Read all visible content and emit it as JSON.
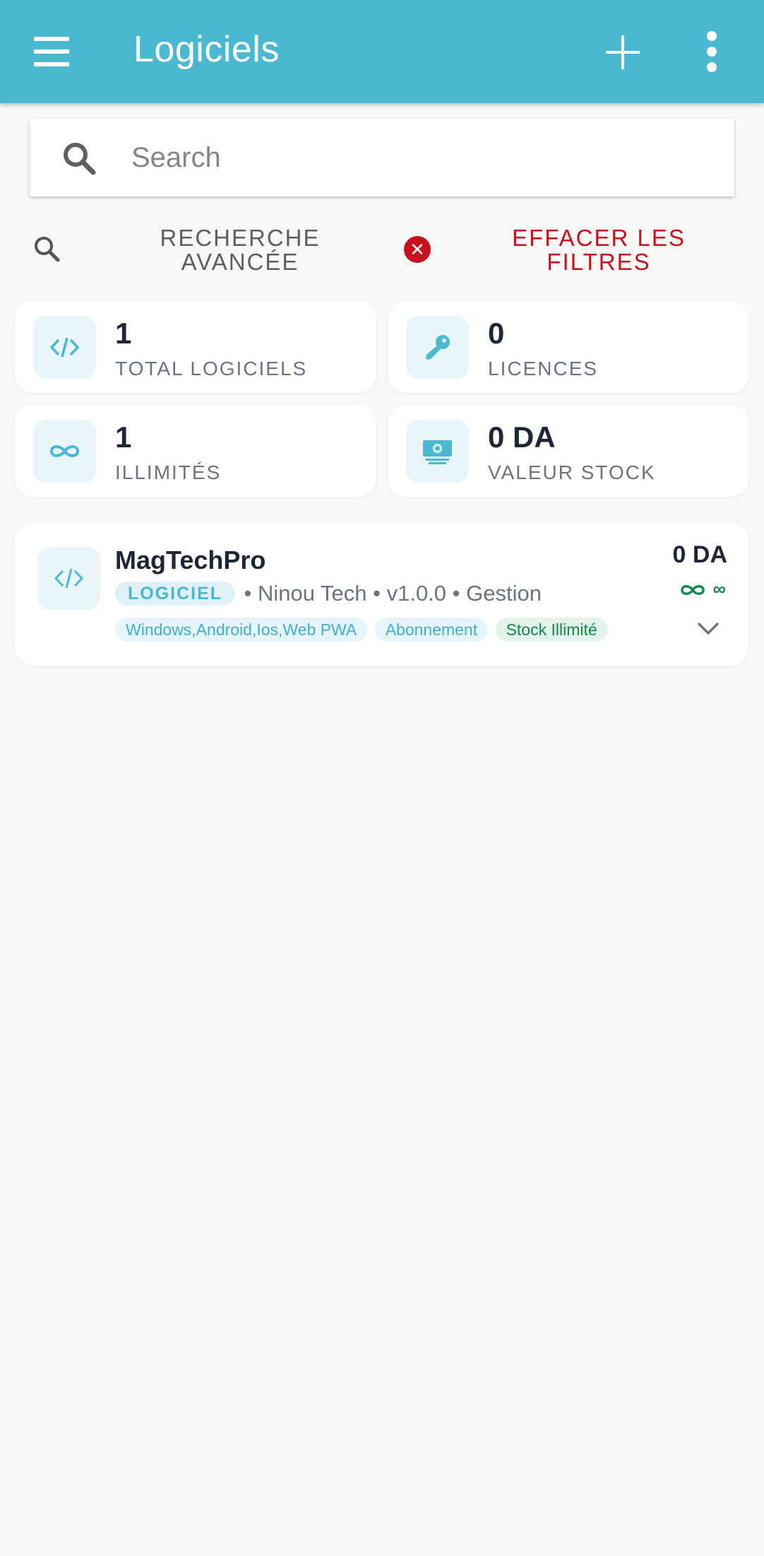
{
  "header": {
    "title": "Logiciels",
    "menu_icon": "hamburger-menu-icon",
    "add_icon": "plus-icon",
    "more_icon": "more-vert-icon",
    "color": "#49b8d1"
  },
  "search": {
    "placeholder": "Search",
    "value": ""
  },
  "filters": {
    "advanced_search_label": "RECHERCHE AVANCÉE",
    "clear_filters_label": "EFFACER LES FILTRES",
    "clear_color": "#c7111e"
  },
  "stats": [
    {
      "value": "1",
      "label": "TOTAL LOGICIELS",
      "icon": "code-icon"
    },
    {
      "value": "0",
      "label": "LICENCES",
      "icon": "key-icon"
    },
    {
      "value": "1",
      "label": "ILLIMITÉS",
      "icon": "infinity-icon"
    },
    {
      "value": "0 DA",
      "label": "VALEUR STOCK",
      "icon": "money-icon"
    }
  ],
  "items": [
    {
      "name": "MagTechPro",
      "type": "LOGICIEL",
      "meta": "• Ninou Tech • v1.0.0 • Gestion",
      "tags": [
        "Windows,Android,Ios,Web PWA",
        "Abonnement",
        "Stock Illimité"
      ],
      "price": "0 DA",
      "stock": "∞"
    }
  ]
}
